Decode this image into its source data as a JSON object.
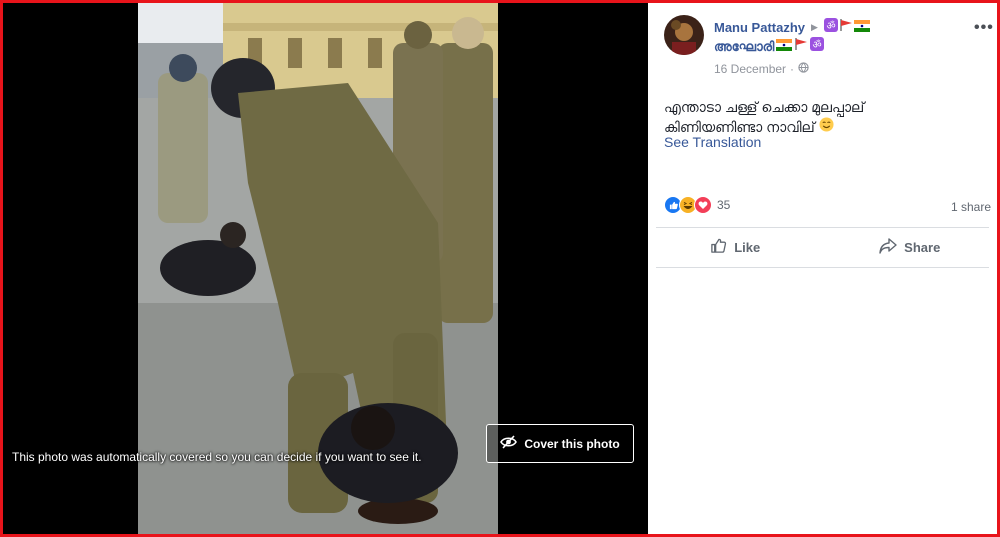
{
  "viewer": {
    "cover_notice": "This photo was automatically covered so you can decide if you want to see it.",
    "cover_button_label": "Cover this photo",
    "cover_icon": "eye-slash-icon"
  },
  "post": {
    "author": "Manu Pattazhy",
    "author_suffix_emojis": [
      "om",
      "red-flag",
      "indian-flag"
    ],
    "alias": "അഘോരി",
    "alias_suffix_emojis": [
      "indian-flag",
      "red-flag",
      "om"
    ],
    "date": "16 December",
    "privacy_icon": "globe-icon",
    "text_line1": "എന്താടാ ചള്ള് ചെക്കാ മുലപ്പാല്",
    "text_line2": "കിണിയണിണ്ടാ നാവില്",
    "text_emoji": "smiling-face",
    "see_translation": "See Translation",
    "reaction_count": "35",
    "reaction_types": [
      "like",
      "haha",
      "love"
    ],
    "share_count": "1 share",
    "like_label": "Like",
    "share_label": "Share"
  },
  "colors": {
    "link": "#385898",
    "frame": "#e8141b",
    "muted": "#606770"
  }
}
